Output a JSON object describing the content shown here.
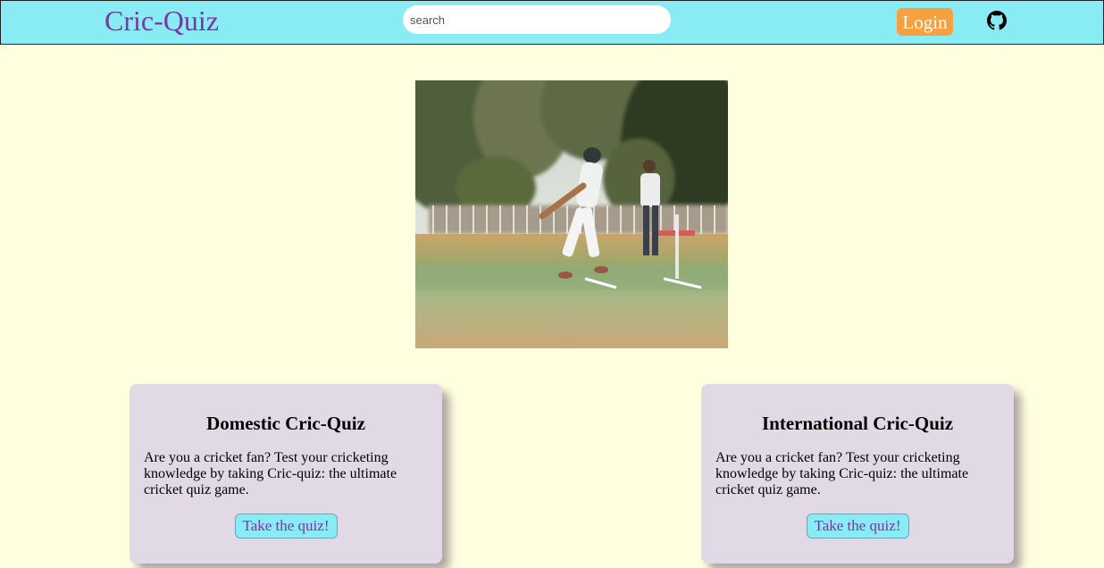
{
  "navbar": {
    "brand": "Cric-Quiz",
    "search_placeholder": "search",
    "login_label": "Login",
    "github_icon": "github-icon"
  },
  "hero": {
    "image": "cricket-batsman-photo"
  },
  "cards": [
    {
      "title": "Domestic Cric-Quiz",
      "text": "Are you a cricket fan? Test your cricketing knowledge by taking Cric-quiz: the ultimate cricket quiz game.",
      "button": "Take the quiz!"
    },
    {
      "title": "International Cric-Quiz",
      "text": "Are you a cricket fan? Test your cricketing knowledge by taking Cric-quiz: the ultimate cricket quiz game.",
      "button": "Take the quiz!"
    }
  ],
  "colors": {
    "page_bg": "#ffffe0",
    "navbar_bg": "#89ecf5",
    "brand": "#7b35a8",
    "login_bg": "#f6a040",
    "card_bg": "#e2d9e6"
  }
}
